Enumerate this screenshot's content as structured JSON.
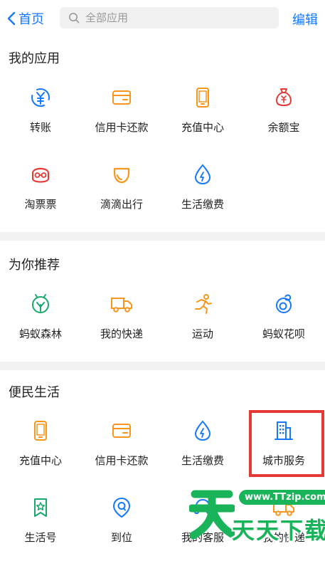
{
  "topbar": {
    "back_label": "首页",
    "search_placeholder": "全部应用",
    "edit_label": "编辑"
  },
  "colors": {
    "accent": "#1677ff",
    "orange": "#f7951d",
    "red": "#e53935",
    "green": "#19b35a",
    "section_bg": "#f2f2f2"
  },
  "sections": [
    {
      "title": "我的应用",
      "items": [
        {
          "label": "转账",
          "icon": "transfer-icon"
        },
        {
          "label": "信用卡还款",
          "icon": "credit-card-icon"
        },
        {
          "label": "充值中心",
          "icon": "phone-icon"
        },
        {
          "label": "余额宝",
          "icon": "money-bag-icon"
        },
        {
          "label": "淘票票",
          "icon": "ticket-face-icon"
        },
        {
          "label": "滴滴出行",
          "icon": "didi-icon"
        },
        {
          "label": "生活缴费",
          "icon": "water-drop-icon"
        }
      ]
    },
    {
      "title": "为你推荐",
      "items": [
        {
          "label": "蚂蚁森林",
          "icon": "forest-icon"
        },
        {
          "label": "我的快递",
          "icon": "truck-icon"
        },
        {
          "label": "运动",
          "icon": "running-icon"
        },
        {
          "label": "蚂蚁花呗",
          "icon": "huabei-icon"
        }
      ]
    },
    {
      "title": "便民生活",
      "items": [
        {
          "label": "充值中心",
          "icon": "phone-icon"
        },
        {
          "label": "信用卡还款",
          "icon": "credit-card-icon"
        },
        {
          "label": "生活缴费",
          "icon": "water-drop-icon"
        },
        {
          "label": "城市服务",
          "icon": "building-icon"
        },
        {
          "label": "生活号",
          "icon": "bookmark-star-icon"
        },
        {
          "label": "到位",
          "icon": "location-icon"
        },
        {
          "label": "我的客服",
          "icon": "customer-service-icon"
        },
        {
          "label": "我的快递",
          "icon": "truck-icon"
        }
      ]
    }
  ],
  "watermark": {
    "url": "www.TTzip.com",
    "text": "天天下载"
  }
}
